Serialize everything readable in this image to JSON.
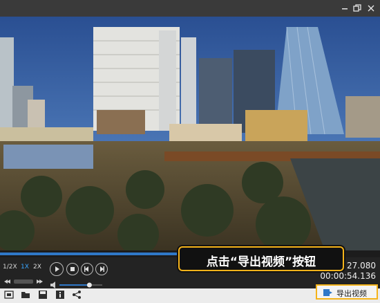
{
  "window": {
    "restore_glyph": "⧉",
    "close_glyph": "✕"
  },
  "video": {
    "description_icon": "city-skyline"
  },
  "playback": {
    "progress_fraction": 0.47,
    "speeds": [
      "1/2X",
      "1X",
      "2X"
    ],
    "active_speed": "1X",
    "time_current": "27.080",
    "time_total": "00:00:54.136",
    "volume_fraction": 0.7
  },
  "toolbar": {
    "icons": [
      "snapshot-icon",
      "open-folder-icon",
      "save-icon",
      "info-icon",
      "share-icon"
    ],
    "export_label": "导出视频"
  },
  "callout": {
    "text": "点击“导出视频”按钮"
  },
  "colors": {
    "accent": "#2f78c8",
    "highlight": "#f5b31a"
  }
}
